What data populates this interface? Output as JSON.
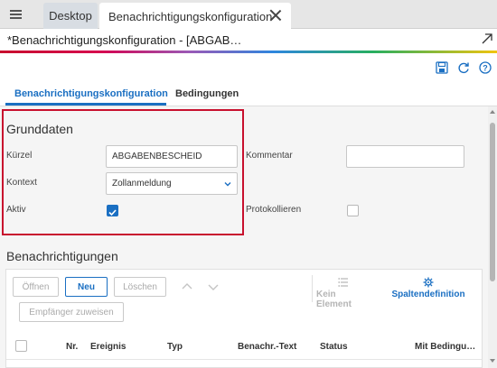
{
  "topbar": {
    "tabs": [
      {
        "label": "Desktop"
      },
      {
        "label": "Benachrichtigungskonfiguration"
      }
    ]
  },
  "document": {
    "title": "*Benachrichtigungskonfiguration - [ABGAB…"
  },
  "subtabs": [
    {
      "label": "Benachrichtigungskonfiguration",
      "active": true
    },
    {
      "label": "Bedingungen",
      "active": false
    }
  ],
  "grunddaten": {
    "title": "Grunddaten",
    "kuerzel_label": "Kürzel",
    "kuerzel_value": "ABGABENBESCHEID",
    "kontext_label": "Kontext",
    "kontext_value": "Zollanmeldung",
    "aktiv_label": "Aktiv",
    "aktiv_checked": true,
    "kommentar_label": "Kommentar",
    "kommentar_value": "",
    "protokollieren_label": "Protokollieren",
    "protokollieren_checked": false
  },
  "benachrichtigungen": {
    "title": "Benachrichtigungen",
    "buttons": {
      "oeffnen": "Öffnen",
      "neu": "Neu",
      "loeschen": "Löschen",
      "empfaenger": "Empfänger zuweisen",
      "kein_element": "Kein Element",
      "spaltendefinition": "Spaltendefinition"
    },
    "columns": [
      "Nr.",
      "Ereignis",
      "Typ",
      "Benachr.-Text",
      "Status",
      "Mit Bedingu…"
    ]
  },
  "colors": {
    "accent": "#1a6fc2",
    "highlight": "#c8102e"
  }
}
